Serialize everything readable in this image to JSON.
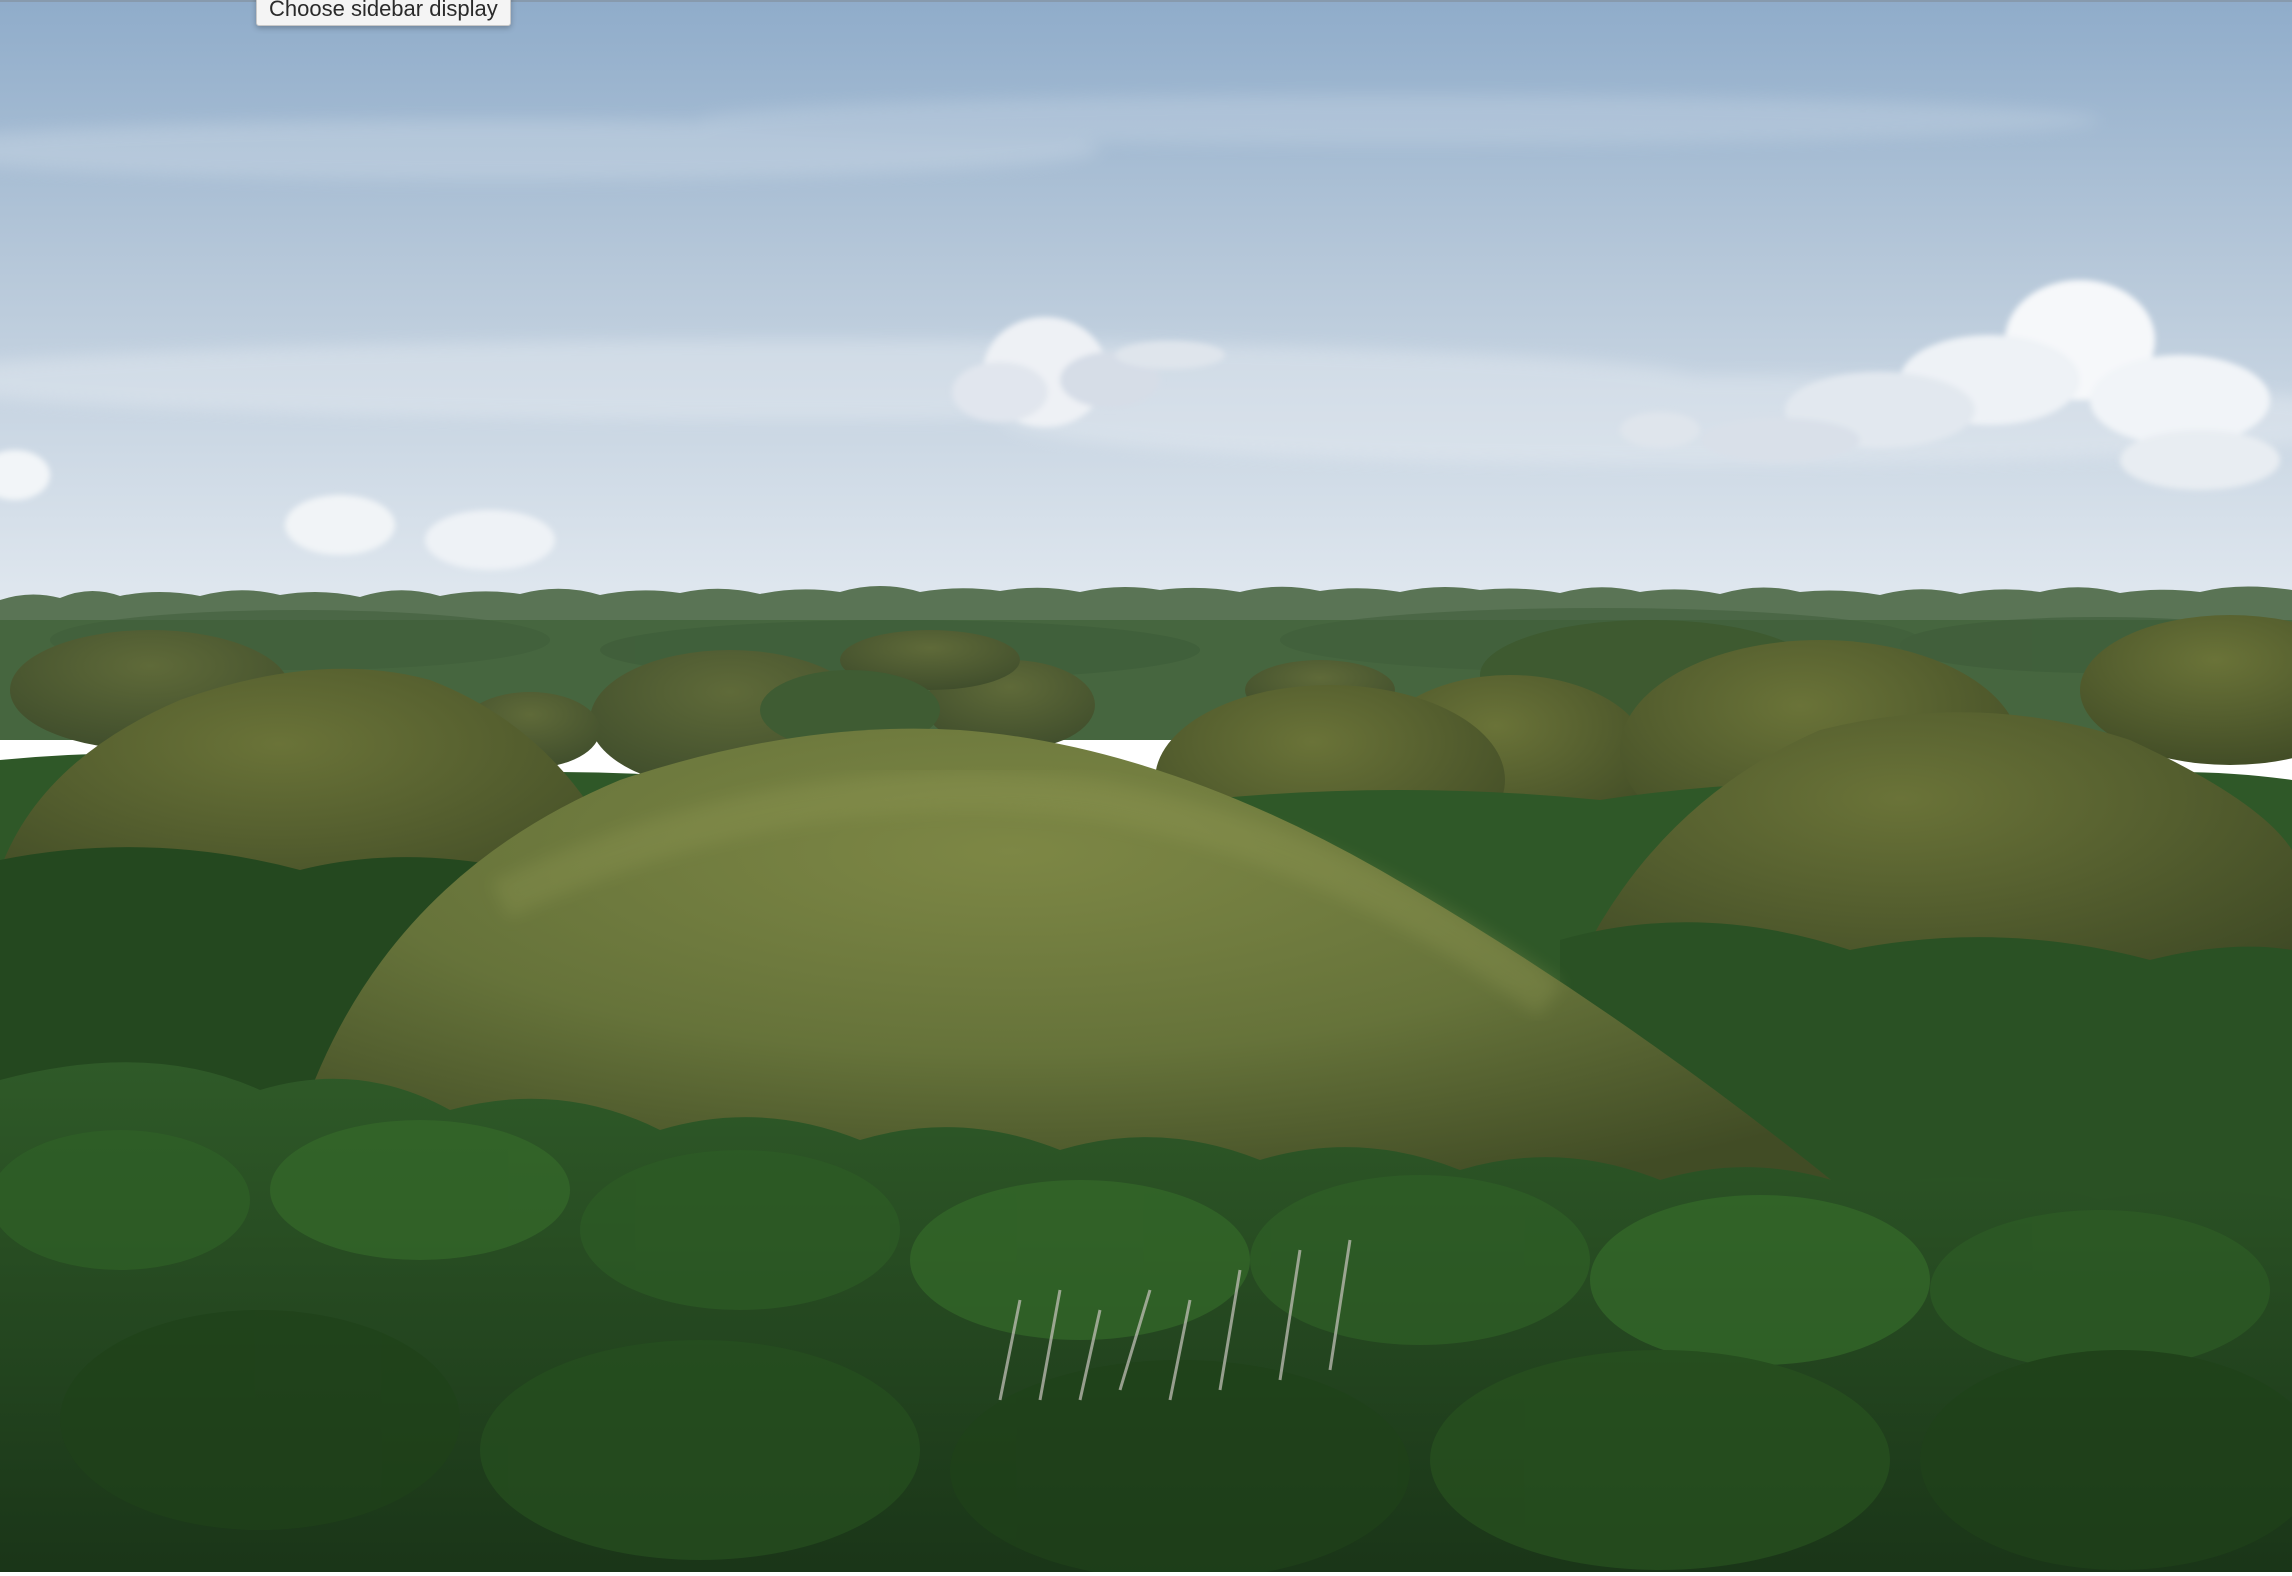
{
  "tooltip": {
    "text": "Choose sidebar display"
  },
  "photo": {
    "subject": "landscape-photo",
    "colors": {
      "sky_top": "#93aecb",
      "sky_horizon": "#dfe7ef",
      "cloud": "#f3f5f8",
      "distant_hills": "#4f6a4d",
      "hill_grass": "#6d7a3f",
      "hill_shadow": "#3f4a26",
      "forest_dark": "#1d3d1c",
      "forest_light": "#3f7a2e"
    }
  }
}
